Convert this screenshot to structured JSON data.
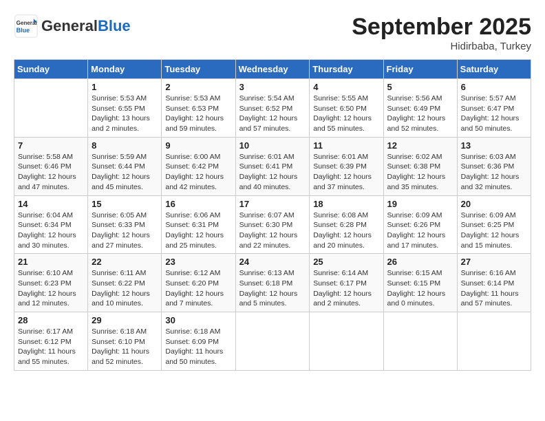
{
  "logo": {
    "general": "General",
    "blue": "Blue"
  },
  "title": "September 2025",
  "location": "Hidirbaba, Turkey",
  "days_header": [
    "Sunday",
    "Monday",
    "Tuesday",
    "Wednesday",
    "Thursday",
    "Friday",
    "Saturday"
  ],
  "weeks": [
    [
      {
        "day": "",
        "info": ""
      },
      {
        "day": "1",
        "info": "Sunrise: 5:53 AM\nSunset: 6:55 PM\nDaylight: 13 hours\nand 2 minutes."
      },
      {
        "day": "2",
        "info": "Sunrise: 5:53 AM\nSunset: 6:53 PM\nDaylight: 12 hours\nand 59 minutes."
      },
      {
        "day": "3",
        "info": "Sunrise: 5:54 AM\nSunset: 6:52 PM\nDaylight: 12 hours\nand 57 minutes."
      },
      {
        "day": "4",
        "info": "Sunrise: 5:55 AM\nSunset: 6:50 PM\nDaylight: 12 hours\nand 55 minutes."
      },
      {
        "day": "5",
        "info": "Sunrise: 5:56 AM\nSunset: 6:49 PM\nDaylight: 12 hours\nand 52 minutes."
      },
      {
        "day": "6",
        "info": "Sunrise: 5:57 AM\nSunset: 6:47 PM\nDaylight: 12 hours\nand 50 minutes."
      }
    ],
    [
      {
        "day": "7",
        "info": "Sunrise: 5:58 AM\nSunset: 6:46 PM\nDaylight: 12 hours\nand 47 minutes."
      },
      {
        "day": "8",
        "info": "Sunrise: 5:59 AM\nSunset: 6:44 PM\nDaylight: 12 hours\nand 45 minutes."
      },
      {
        "day": "9",
        "info": "Sunrise: 6:00 AM\nSunset: 6:42 PM\nDaylight: 12 hours\nand 42 minutes."
      },
      {
        "day": "10",
        "info": "Sunrise: 6:01 AM\nSunset: 6:41 PM\nDaylight: 12 hours\nand 40 minutes."
      },
      {
        "day": "11",
        "info": "Sunrise: 6:01 AM\nSunset: 6:39 PM\nDaylight: 12 hours\nand 37 minutes."
      },
      {
        "day": "12",
        "info": "Sunrise: 6:02 AM\nSunset: 6:38 PM\nDaylight: 12 hours\nand 35 minutes."
      },
      {
        "day": "13",
        "info": "Sunrise: 6:03 AM\nSunset: 6:36 PM\nDaylight: 12 hours\nand 32 minutes."
      }
    ],
    [
      {
        "day": "14",
        "info": "Sunrise: 6:04 AM\nSunset: 6:34 PM\nDaylight: 12 hours\nand 30 minutes."
      },
      {
        "day": "15",
        "info": "Sunrise: 6:05 AM\nSunset: 6:33 PM\nDaylight: 12 hours\nand 27 minutes."
      },
      {
        "day": "16",
        "info": "Sunrise: 6:06 AM\nSunset: 6:31 PM\nDaylight: 12 hours\nand 25 minutes."
      },
      {
        "day": "17",
        "info": "Sunrise: 6:07 AM\nSunset: 6:30 PM\nDaylight: 12 hours\nand 22 minutes."
      },
      {
        "day": "18",
        "info": "Sunrise: 6:08 AM\nSunset: 6:28 PM\nDaylight: 12 hours\nand 20 minutes."
      },
      {
        "day": "19",
        "info": "Sunrise: 6:09 AM\nSunset: 6:26 PM\nDaylight: 12 hours\nand 17 minutes."
      },
      {
        "day": "20",
        "info": "Sunrise: 6:09 AM\nSunset: 6:25 PM\nDaylight: 12 hours\nand 15 minutes."
      }
    ],
    [
      {
        "day": "21",
        "info": "Sunrise: 6:10 AM\nSunset: 6:23 PM\nDaylight: 12 hours\nand 12 minutes."
      },
      {
        "day": "22",
        "info": "Sunrise: 6:11 AM\nSunset: 6:22 PM\nDaylight: 12 hours\nand 10 minutes."
      },
      {
        "day": "23",
        "info": "Sunrise: 6:12 AM\nSunset: 6:20 PM\nDaylight: 12 hours\nand 7 minutes."
      },
      {
        "day": "24",
        "info": "Sunrise: 6:13 AM\nSunset: 6:18 PM\nDaylight: 12 hours\nand 5 minutes."
      },
      {
        "day": "25",
        "info": "Sunrise: 6:14 AM\nSunset: 6:17 PM\nDaylight: 12 hours\nand 2 minutes."
      },
      {
        "day": "26",
        "info": "Sunrise: 6:15 AM\nSunset: 6:15 PM\nDaylight: 12 hours\nand 0 minutes."
      },
      {
        "day": "27",
        "info": "Sunrise: 6:16 AM\nSunset: 6:14 PM\nDaylight: 11 hours\nand 57 minutes."
      }
    ],
    [
      {
        "day": "28",
        "info": "Sunrise: 6:17 AM\nSunset: 6:12 PM\nDaylight: 11 hours\nand 55 minutes."
      },
      {
        "day": "29",
        "info": "Sunrise: 6:18 AM\nSunset: 6:10 PM\nDaylight: 11 hours\nand 52 minutes."
      },
      {
        "day": "30",
        "info": "Sunrise: 6:18 AM\nSunset: 6:09 PM\nDaylight: 11 hours\nand 50 minutes."
      },
      {
        "day": "",
        "info": ""
      },
      {
        "day": "",
        "info": ""
      },
      {
        "day": "",
        "info": ""
      },
      {
        "day": "",
        "info": ""
      }
    ]
  ]
}
